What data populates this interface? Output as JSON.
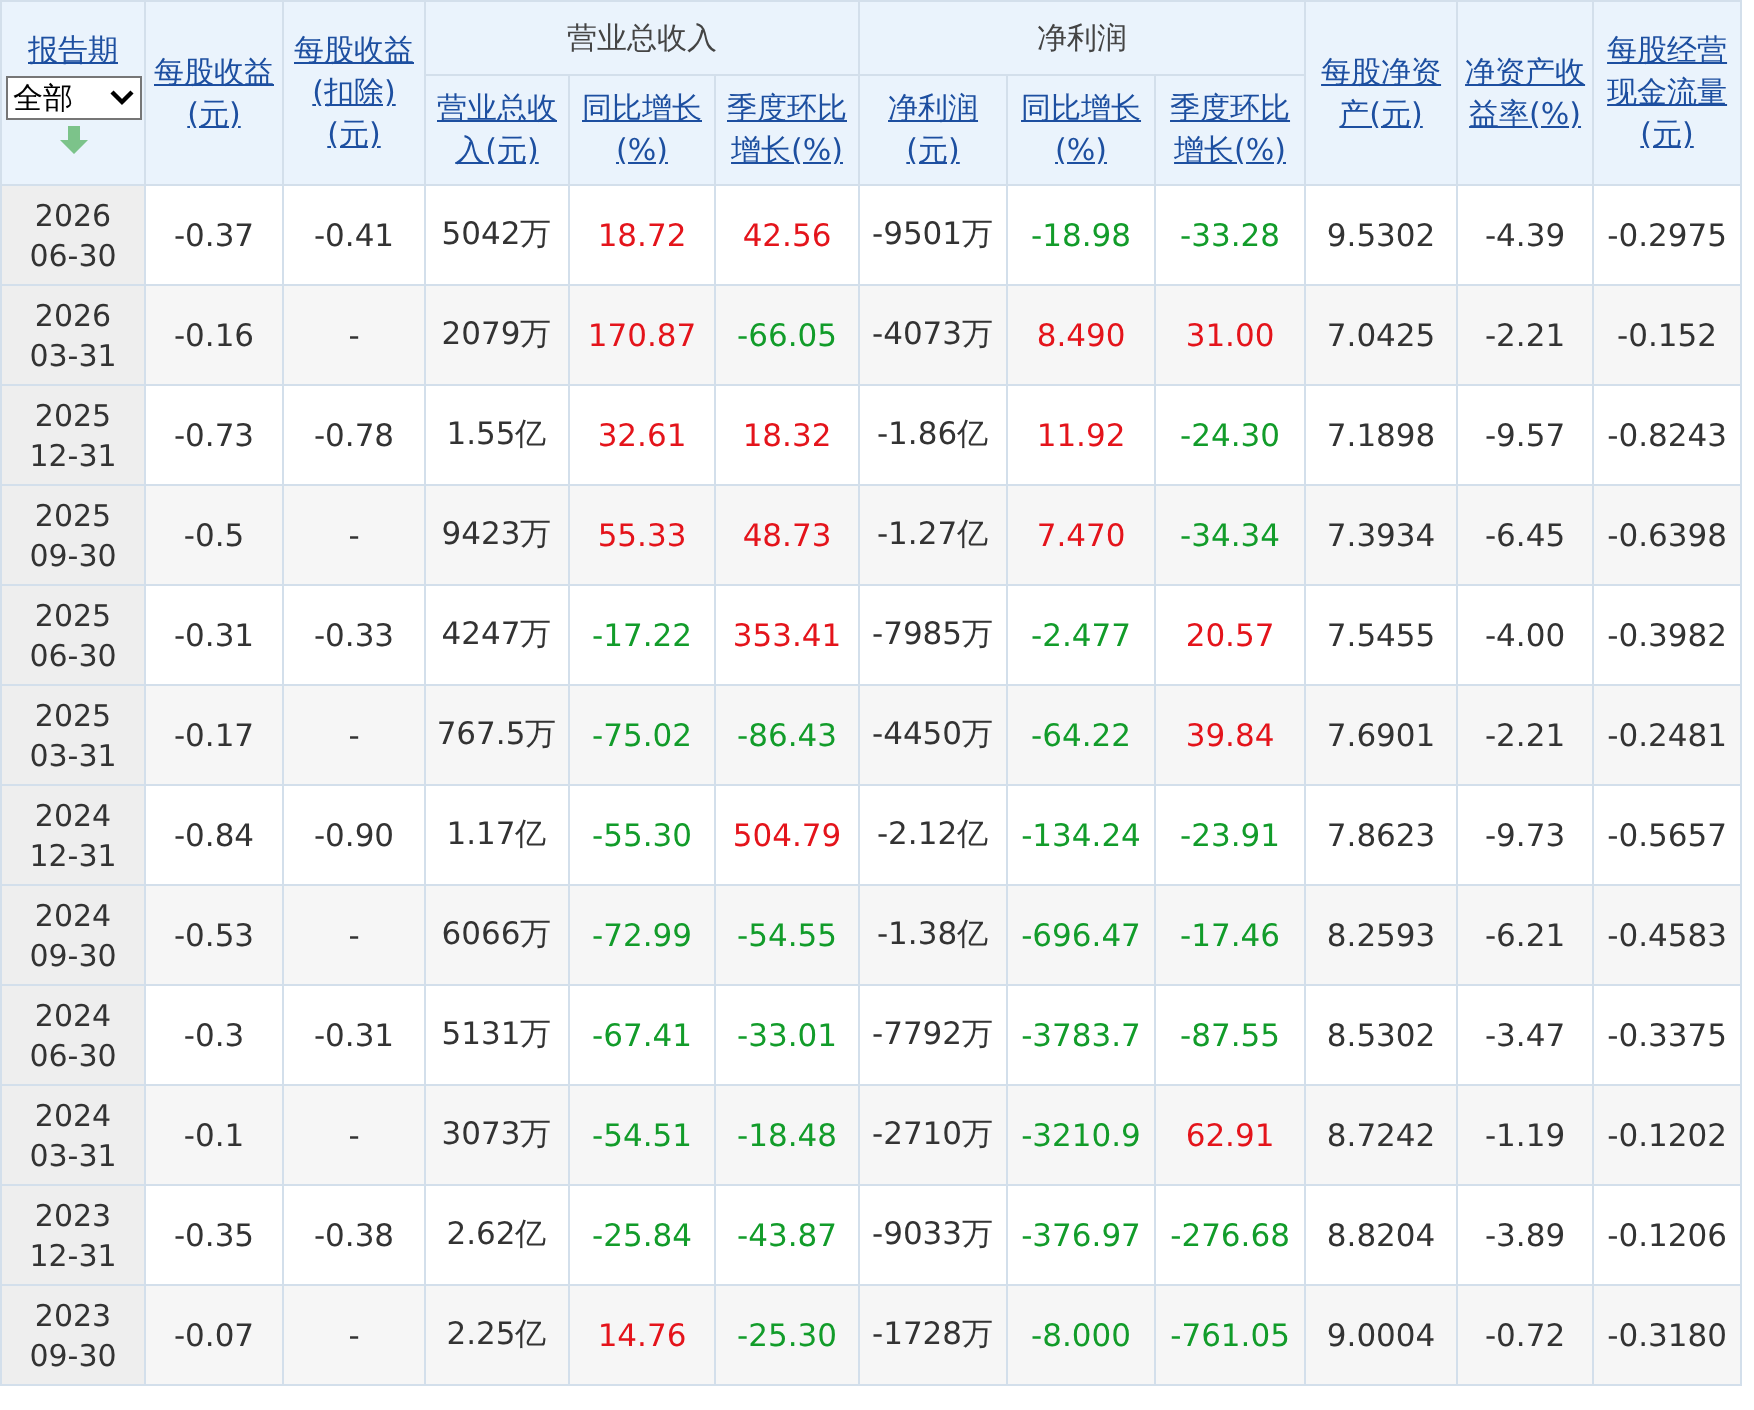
{
  "period": {
    "label": "报告期",
    "filter": {
      "value": "全部"
    }
  },
  "columns": [
    {
      "kind": "single",
      "label": "每股收益(元)"
    },
    {
      "kind": "single",
      "label": "每股收益(扣除)(元)"
    },
    {
      "kind": "group",
      "label": "营业总收入",
      "children": [
        {
          "label": "营业总收入(元)"
        },
        {
          "label": "同比增长(%)"
        },
        {
          "label": "季度环比增长(%)"
        }
      ]
    },
    {
      "kind": "group",
      "label": "净利润",
      "children": [
        {
          "label": "净利润(元)"
        },
        {
          "label": "同比增长(%)"
        },
        {
          "label": "季度环比增长(%)"
        }
      ]
    },
    {
      "kind": "single",
      "label": "每股净资产(元)"
    },
    {
      "kind": "single",
      "label": "净资产收益率(%)"
    },
    {
      "kind": "single",
      "label": "每股经营现金流量(元)"
    }
  ],
  "rows": [
    {
      "year": "2026",
      "date": "06-30",
      "cells": [
        {
          "text": "-0.37"
        },
        {
          "text": "-0.41"
        },
        {
          "text": "5042万"
        },
        {
          "text": "18.72",
          "color": "#e4141b"
        },
        {
          "text": "42.56",
          "color": "#e4141b"
        },
        {
          "text": "-9501万"
        },
        {
          "text": "-18.98",
          "color": "#129c2a"
        },
        {
          "text": "-33.28",
          "color": "#129c2a"
        },
        {
          "text": "9.5302"
        },
        {
          "text": "-4.39"
        },
        {
          "text": "-0.2975"
        }
      ]
    },
    {
      "year": "2026",
      "date": "03-31",
      "cells": [
        {
          "text": "-0.16"
        },
        {
          "text": "-"
        },
        {
          "text": "2079万"
        },
        {
          "text": "170.87",
          "color": "#e4141b"
        },
        {
          "text": "-66.05",
          "color": "#129c2a"
        },
        {
          "text": "-4073万"
        },
        {
          "text": "8.490",
          "color": "#e4141b"
        },
        {
          "text": "31.00",
          "color": "#e4141b"
        },
        {
          "text": "7.0425"
        },
        {
          "text": "-2.21"
        },
        {
          "text": "-0.152"
        }
      ]
    },
    {
      "year": "2025",
      "date": "12-31",
      "cells": [
        {
          "text": "-0.73"
        },
        {
          "text": "-0.78"
        },
        {
          "text": "1.55亿"
        },
        {
          "text": "32.61",
          "color": "#e4141b"
        },
        {
          "text": "18.32",
          "color": "#e4141b"
        },
        {
          "text": "-1.86亿"
        },
        {
          "text": "11.92",
          "color": "#e4141b"
        },
        {
          "text": "-24.30",
          "color": "#129c2a"
        },
        {
          "text": "7.1898"
        },
        {
          "text": "-9.57"
        },
        {
          "text": "-0.8243"
        }
      ]
    },
    {
      "year": "2025",
      "date": "09-30",
      "cells": [
        {
          "text": "-0.5"
        },
        {
          "text": "-"
        },
        {
          "text": "9423万"
        },
        {
          "text": "55.33",
          "color": "#e4141b"
        },
        {
          "text": "48.73",
          "color": "#e4141b"
        },
        {
          "text": "-1.27亿"
        },
        {
          "text": "7.470",
          "color": "#e4141b"
        },
        {
          "text": "-34.34",
          "color": "#129c2a"
        },
        {
          "text": "7.3934"
        },
        {
          "text": "-6.45"
        },
        {
          "text": "-0.6398"
        }
      ]
    },
    {
      "year": "2025",
      "date": "06-30",
      "cells": [
        {
          "text": "-0.31"
        },
        {
          "text": "-0.33"
        },
        {
          "text": "4247万"
        },
        {
          "text": "-17.22",
          "color": "#129c2a"
        },
        {
          "text": "353.41",
          "color": "#e4141b"
        },
        {
          "text": "-7985万"
        },
        {
          "text": "-2.477",
          "color": "#129c2a"
        },
        {
          "text": "20.57",
          "color": "#e4141b"
        },
        {
          "text": "7.5455"
        },
        {
          "text": "-4.00"
        },
        {
          "text": "-0.3982"
        }
      ]
    },
    {
      "year": "2025",
      "date": "03-31",
      "cells": [
        {
          "text": "-0.17"
        },
        {
          "text": "-"
        },
        {
          "text": "767.5万"
        },
        {
          "text": "-75.02",
          "color": "#129c2a"
        },
        {
          "text": "-86.43",
          "color": "#129c2a"
        },
        {
          "text": "-4450万"
        },
        {
          "text": "-64.22",
          "color": "#129c2a"
        },
        {
          "text": "39.84",
          "color": "#e4141b"
        },
        {
          "text": "7.6901"
        },
        {
          "text": "-2.21"
        },
        {
          "text": "-0.2481"
        }
      ]
    },
    {
      "year": "2024",
      "date": "12-31",
      "cells": [
        {
          "text": "-0.84"
        },
        {
          "text": "-0.90"
        },
        {
          "text": "1.17亿"
        },
        {
          "text": "-55.30",
          "color": "#129c2a"
        },
        {
          "text": "504.79",
          "color": "#e4141b"
        },
        {
          "text": "-2.12亿"
        },
        {
          "text": "-134.24",
          "color": "#129c2a"
        },
        {
          "text": "-23.91",
          "color": "#129c2a"
        },
        {
          "text": "7.8623"
        },
        {
          "text": "-9.73"
        },
        {
          "text": "-0.5657"
        }
      ]
    },
    {
      "year": "2024",
      "date": "09-30",
      "cells": [
        {
          "text": "-0.53"
        },
        {
          "text": "-"
        },
        {
          "text": "6066万"
        },
        {
          "text": "-72.99",
          "color": "#129c2a"
        },
        {
          "text": "-54.55",
          "color": "#129c2a"
        },
        {
          "text": "-1.38亿"
        },
        {
          "text": "-696.47",
          "color": "#129c2a"
        },
        {
          "text": "-17.46",
          "color": "#129c2a"
        },
        {
          "text": "8.2593"
        },
        {
          "text": "-6.21"
        },
        {
          "text": "-0.4583"
        }
      ]
    },
    {
      "year": "2024",
      "date": "06-30",
      "cells": [
        {
          "text": "-0.3"
        },
        {
          "text": "-0.31"
        },
        {
          "text": "5131万"
        },
        {
          "text": "-67.41",
          "color": "#129c2a"
        },
        {
          "text": "-33.01",
          "color": "#129c2a"
        },
        {
          "text": "-7792万"
        },
        {
          "text": "-3783.7",
          "color": "#129c2a"
        },
        {
          "text": "-87.55",
          "color": "#129c2a"
        },
        {
          "text": "8.5302"
        },
        {
          "text": "-3.47"
        },
        {
          "text": "-0.3375"
        }
      ]
    },
    {
      "year": "2024",
      "date": "03-31",
      "cells": [
        {
          "text": "-0.1"
        },
        {
          "text": "-"
        },
        {
          "text": "3073万"
        },
        {
          "text": "-54.51",
          "color": "#129c2a"
        },
        {
          "text": "-18.48",
          "color": "#129c2a"
        },
        {
          "text": "-2710万"
        },
        {
          "text": "-3210.9",
          "color": "#129c2a"
        },
        {
          "text": "62.91",
          "color": "#e4141b"
        },
        {
          "text": "8.7242"
        },
        {
          "text": "-1.19"
        },
        {
          "text": "-0.1202"
        }
      ]
    },
    {
      "year": "2023",
      "date": "12-31",
      "cells": [
        {
          "text": "-0.35"
        },
        {
          "text": "-0.38"
        },
        {
          "text": "2.62亿"
        },
        {
          "text": "-25.84",
          "color": "#129c2a"
        },
        {
          "text": "-43.87",
          "color": "#129c2a"
        },
        {
          "text": "-9033万"
        },
        {
          "text": "-376.97",
          "color": "#129c2a"
        },
        {
          "text": "-276.68",
          "color": "#129c2a"
        },
        {
          "text": "8.8204"
        },
        {
          "text": "-3.89"
        },
        {
          "text": "-0.1206"
        }
      ]
    },
    {
      "year": "2023",
      "date": "09-30",
      "cells": [
        {
          "text": "-0.07"
        },
        {
          "text": "-"
        },
        {
          "text": "2.25亿"
        },
        {
          "text": "14.76",
          "color": "#e4141b"
        },
        {
          "text": "-25.30",
          "color": "#129c2a"
        },
        {
          "text": "-1728万"
        },
        {
          "text": "-8.000",
          "color": "#129c2a"
        },
        {
          "text": "-761.05",
          "color": "#129c2a"
        },
        {
          "text": "9.0004"
        },
        {
          "text": "-0.72"
        },
        {
          "text": "-0.3180"
        }
      ]
    }
  ]
}
